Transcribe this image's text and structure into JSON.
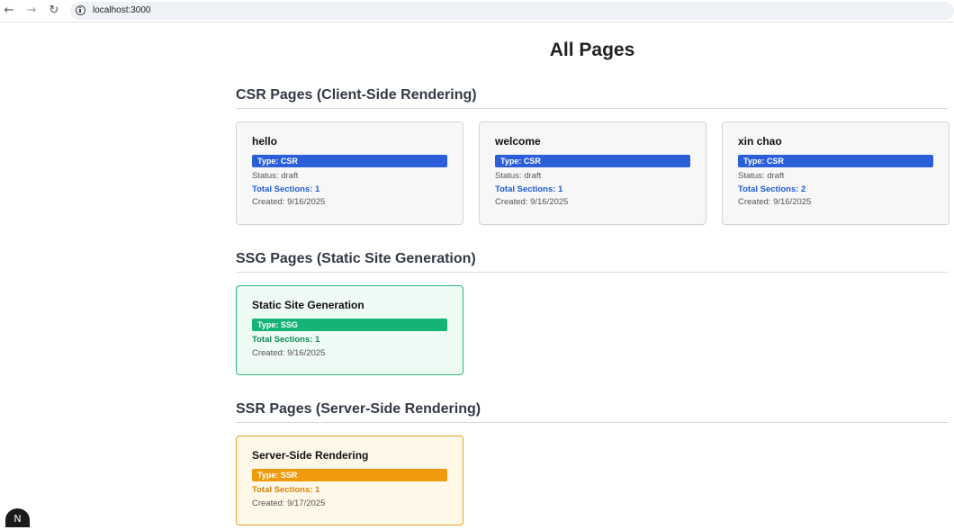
{
  "browser": {
    "url": "localhost:3000",
    "back_icon": "←",
    "forward_icon": "→",
    "reload_icon": "↻"
  },
  "page": {
    "title": "All Pages"
  },
  "sections": {
    "csr": {
      "heading": "CSR Pages (Client-Side Rendering)",
      "cards": [
        {
          "title": "hello",
          "type": "Type: CSR",
          "status": "Status: draft",
          "sections": "Total Sections: 1",
          "created": "Created: 9/16/2025"
        },
        {
          "title": "welcome",
          "type": "Type: CSR",
          "status": "Status: draft",
          "sections": "Total Sections: 1",
          "created": "Created: 9/16/2025"
        },
        {
          "title": "xin chao",
          "type": "Type: CSR",
          "status": "Status: draft",
          "sections": "Total Sections: 2",
          "created": "Created: 9/16/2025"
        }
      ]
    },
    "ssg": {
      "heading": "SSG Pages (Static Site Generation)",
      "cards": [
        {
          "title": "Static Site Generation",
          "type": "Type: SSG",
          "sections": "Total Sections: 1",
          "created": "Created: 9/16/2025"
        }
      ]
    },
    "ssr": {
      "heading": "SSR Pages (Server-Side Rendering)",
      "cards": [
        {
          "title": "Server-Side Rendering",
          "type": "Type: SSR",
          "sections": "Total Sections: 1",
          "created": "Created: 9/17/2025"
        }
      ]
    }
  },
  "dev_badge": {
    "label": "N"
  },
  "colors": {
    "csr_accent": "#2b5fd9",
    "ssg_accent": "#14b477",
    "ssr_accent": "#f19b0c"
  }
}
